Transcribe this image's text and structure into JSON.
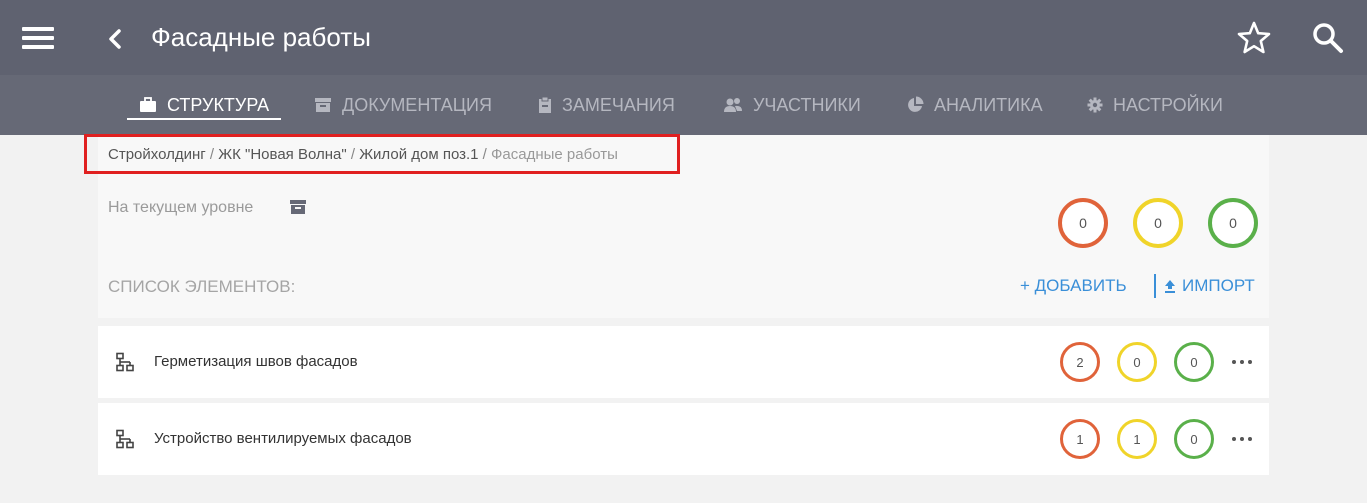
{
  "header": {
    "title": "Фасадные работы",
    "icons": [
      "menu-icon",
      "back-icon",
      "star-icon",
      "search-icon"
    ]
  },
  "tabs": [
    {
      "label": "СТРУКТУРА",
      "icon": "briefcase-icon",
      "active": true
    },
    {
      "label": "ДОКУМЕНТАЦИЯ",
      "icon": "archive-icon",
      "active": false
    },
    {
      "label": "ЗАМЕЧАНИЯ",
      "icon": "clipboard-icon",
      "active": false
    },
    {
      "label": "УЧАСТНИКИ",
      "icon": "users-icon",
      "active": false
    },
    {
      "label": "АНАЛИТИКА",
      "icon": "pie-chart-icon",
      "active": false
    },
    {
      "label": "НАСТРОЙКИ",
      "icon": "gear-icon",
      "active": false
    }
  ],
  "breadcrumb": {
    "items": [
      "Стройхолдинг",
      "ЖК \"Новая Волна\"",
      "Жилой дом поз.1"
    ],
    "separator": " / ",
    "current": "Фасадные работы"
  },
  "level": {
    "label": "На текущем уровне",
    "counts": [
      "0",
      "0",
      "0"
    ]
  },
  "list": {
    "label": "СПИСОК ЭЛЕМЕНТОВ:",
    "add_label": "+ ДОБАВИТЬ",
    "import_label": "ИМПОРТ",
    "items": [
      {
        "name": "Герметизация швов фасадов",
        "counts": [
          "2",
          "0",
          "0"
        ]
      },
      {
        "name": "Устройство вентилируемых фасадов",
        "counts": [
          "1",
          "1",
          "0"
        ]
      }
    ]
  },
  "colors": {
    "header_bg": "#5f6270",
    "tabbar_bg": "#666976",
    "accent_blue": "#3a8fd8",
    "status_orange": "#e0633a",
    "status_yellow": "#f0d42a",
    "status_green": "#5ab04a",
    "highlight_red": "#e02020"
  }
}
